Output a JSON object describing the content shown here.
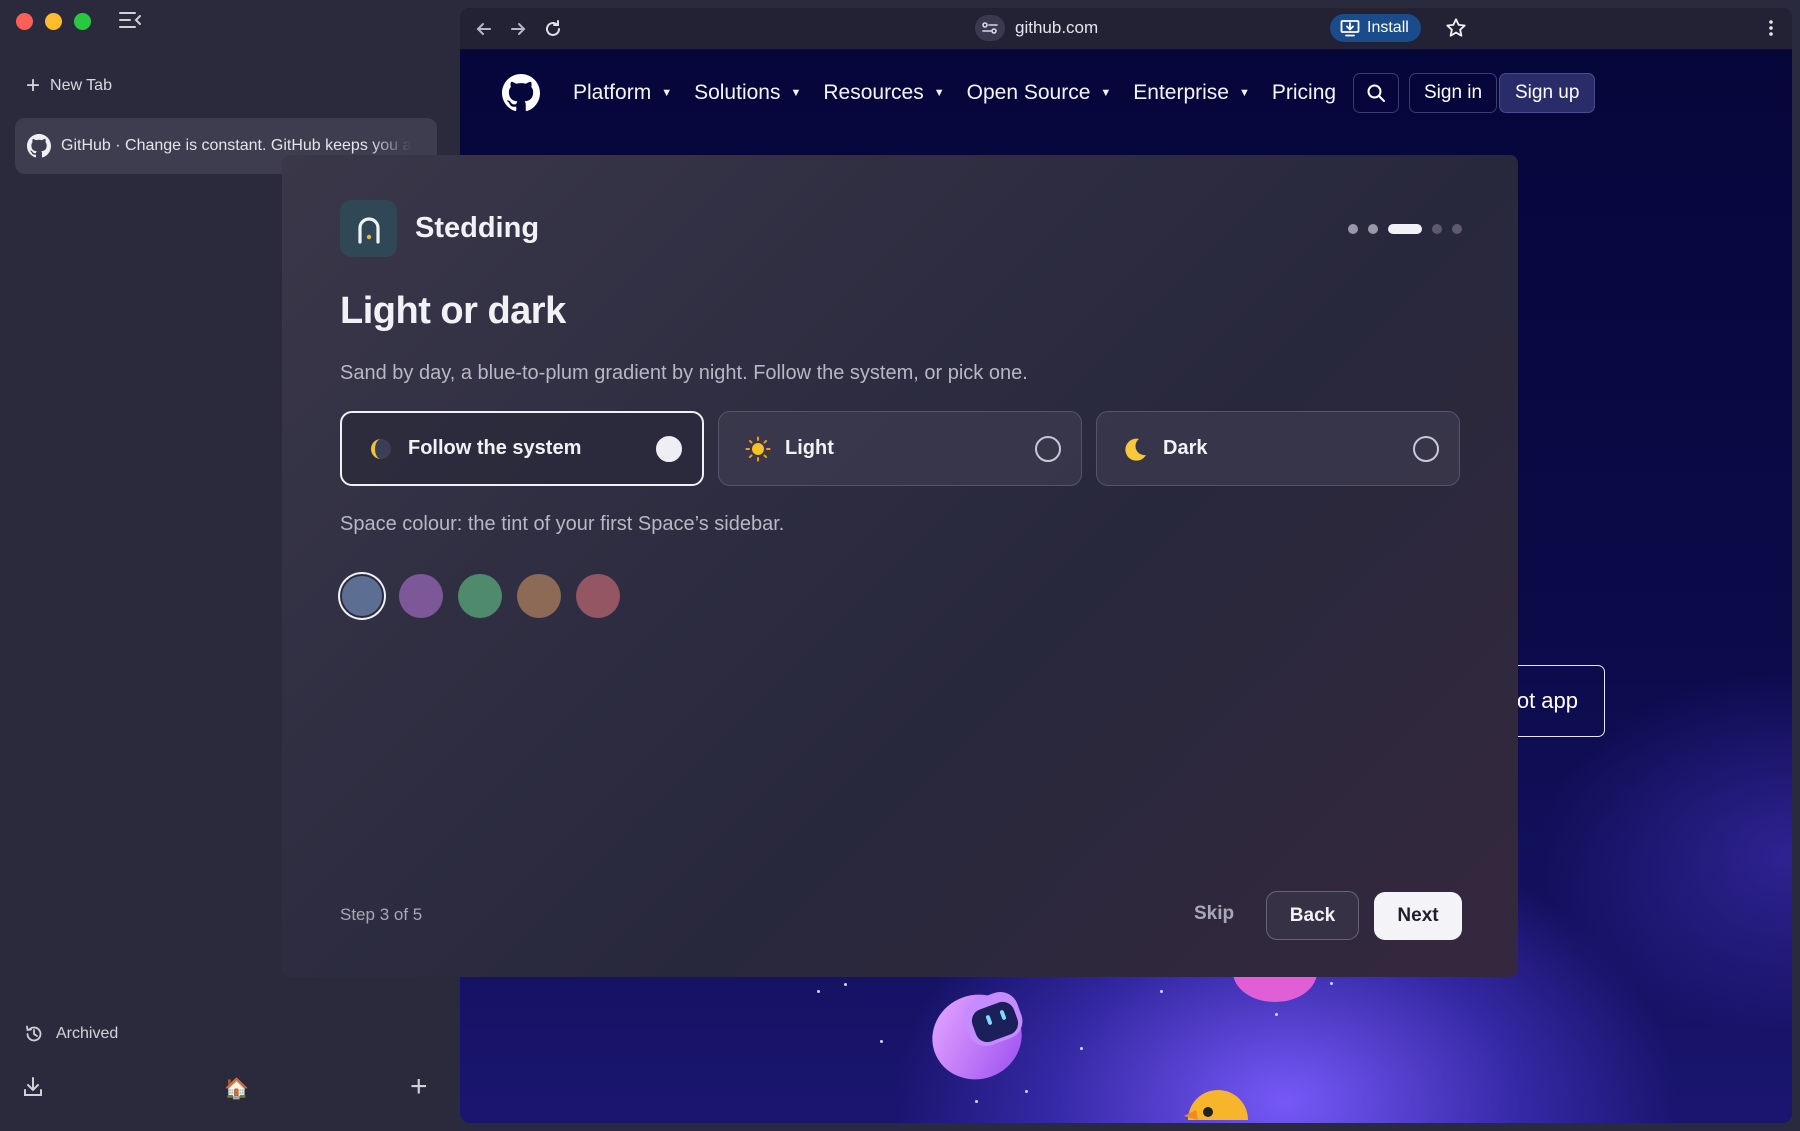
{
  "sidebar": {
    "new_tab_label": "New Tab",
    "active_tab_title": "GitHub · Change is constant. GitHub keeps you ahead.",
    "archived_label": "Archived",
    "home_emoji": "🏠"
  },
  "toolbar": {
    "url": "github.com",
    "install_label": "Install"
  },
  "github": {
    "menu": [
      {
        "label": "Platform",
        "dropdown": true
      },
      {
        "label": "Solutions",
        "dropdown": true
      },
      {
        "label": "Resources",
        "dropdown": true
      },
      {
        "label": "Open Source",
        "dropdown": true
      },
      {
        "label": "Enterprise",
        "dropdown": true
      },
      {
        "label": "Pricing",
        "dropdown": false
      }
    ],
    "sign_in": "Sign in",
    "sign_up": "Sign up",
    "copilot_button_visible_text": "ot app"
  },
  "dialog": {
    "brand_name": "Stedding",
    "progress": {
      "current": 3,
      "total": 5
    },
    "title": "Light or dark",
    "subtitle": "Sand by day, a blue-to-plum gradient by night. Follow the system, or pick one.",
    "theme_options": [
      {
        "label": "Follow the system",
        "icon": "half-moon-icon",
        "selected": true
      },
      {
        "label": "Light",
        "icon": "sun-icon",
        "selected": false
      },
      {
        "label": "Dark",
        "icon": "crescent-moon-icon",
        "selected": false
      }
    ],
    "space_colour_label": "Space colour: the tint of your first Space’s sidebar.",
    "swatches": [
      {
        "name": "slate-blue",
        "color": "#5d6e93",
        "selected": true
      },
      {
        "name": "purple",
        "color": "#7d5898",
        "selected": false
      },
      {
        "name": "green",
        "color": "#4f8a6c",
        "selected": false
      },
      {
        "name": "brown",
        "color": "#8c6a55",
        "selected": false
      },
      {
        "name": "rose",
        "color": "#945663",
        "selected": false
      }
    ],
    "step_text": "Step 3 of 5",
    "skip_label": "Skip",
    "back_label": "Back",
    "next_label": "Next"
  }
}
